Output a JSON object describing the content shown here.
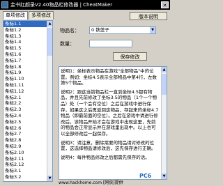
{
  "window": {
    "title": "金书红颜录V2.40物品栏修改器 | CheatMaker",
    "close_glyph": "✕"
  },
  "tabs": [
    {
      "label": "单项修改",
      "active": true
    },
    {
      "label": "多项修改",
      "active": false
    }
  ],
  "version_button": "版本说明",
  "list": {
    "items": [
      "条标1.1",
      "条标1.2",
      "条标1.3",
      "条标1.4",
      "条标1.5",
      "条标1.6",
      "条标1.7",
      "条标1.8",
      "条标1.9",
      "条标1.10",
      "条标1.11",
      "条标1.12",
      "条标2.1",
      "条标2.2",
      "条标2.3",
      "条标2.4",
      "条标2.5",
      "条标2.6",
      "条标2.7",
      "条标2.8",
      "条标2.9",
      "条标2.10",
      "条标2.11",
      "条标2.12",
      "条标3.1",
      "条标3.2"
    ],
    "selected_index": 0
  },
  "form": {
    "item_label": "物品名：",
    "item_value": "0 铁莲子",
    "qty_label": "数量：",
    "qty_value": "",
    "save_button": "保存修改"
  },
  "notes": [
    "说明1：坐标表示物品在游戏\"全部物品\"中的位置。例如：坐标4.5表示全部物品中第4行，左数第5个物品。",
    "说明2：跟这当前物品栏一直到坐标4.5都有物品，并且先前修改了坐标3.5的物品（1个一个物品）处（一个会有空位）之后在游戏中进行保存，如果这之后再返回这物品，存起来的坐标4.7物品（即最前面的空位）。之后在游戏中请进行修改后，该物品开始才会在游戏中出现这里，先前的物品会正常显示并在游戏里出现中。以上也可以全部修改后一起保存。",
    "说明3：请注意，删除需要的物品请对修改的位置，这选择物品请修改后，这先保存进行正确。",
    "说明4：每件物品修改之后都需先保存的话。"
  ],
  "watermark": {
    "url": "www.hackhome.com [网侠]提供",
    "logo_text": "PC6"
  }
}
